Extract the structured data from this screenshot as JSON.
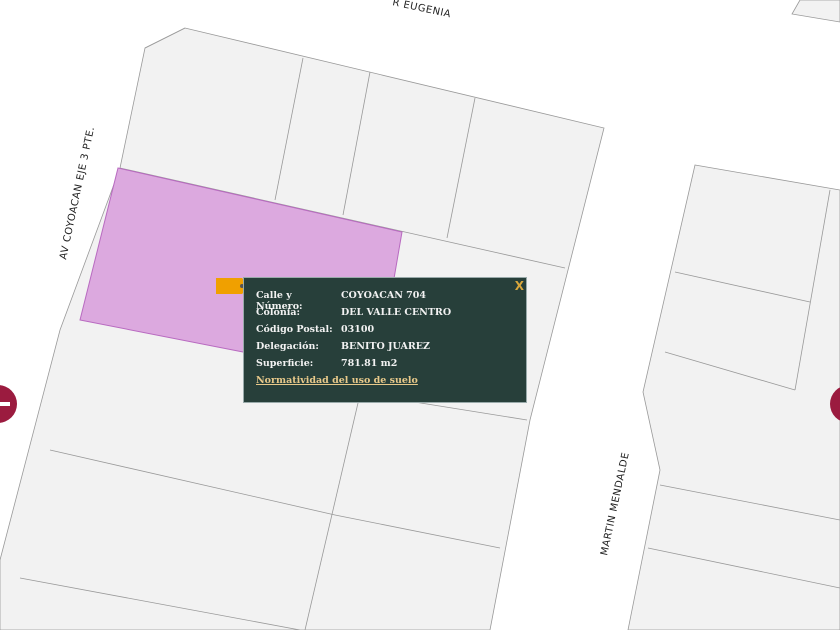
{
  "map": {
    "streets": [
      "R EUGENIA",
      "AV COYOACAN EJE 3 PTE.",
      "MARTIN MENDALDE"
    ],
    "highlight_color": "#dca9df"
  },
  "popup": {
    "rows": [
      {
        "label": "Calle y Número:",
        "value": "COYOACAN 704"
      },
      {
        "label": "Colonia:",
        "value": "DEL VALLE CENTRO"
      },
      {
        "label": "Código Postal:",
        "value": "03100"
      },
      {
        "label": "Delegación:",
        "value": "BENITO JUAREZ"
      },
      {
        "label": "Superficie:",
        "value": "781.81 m2"
      }
    ],
    "link": "Normatividad del uso de suelo",
    "close": "X"
  }
}
